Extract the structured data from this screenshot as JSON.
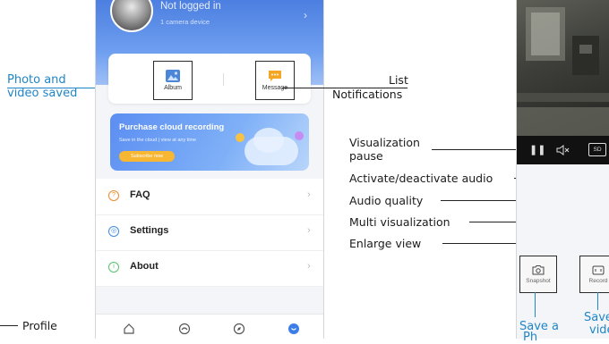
{
  "annotations": {
    "photo_video_saved_line1": "Photo and",
    "photo_video_saved_line2": "video saved",
    "list": "List",
    "notifications": "Notifications",
    "viz_pause_line1": "Visualization",
    "viz_pause_line2": "pause",
    "audio_toggle": "Activate/deactivate audio",
    "audio_quality": "Audio quality",
    "multi_viz": "Multi visualization",
    "enlarge": "Enlarge view",
    "profile": "Profile",
    "save_photo_line1": "Save a",
    "save_photo_line2": "Ph",
    "save_video_line1": "Save",
    "save_video_line2": "vide"
  },
  "app": {
    "header": {
      "title": "Not logged in",
      "subtitle": "1 camera device"
    },
    "album_label": "Album",
    "message_label": "Message",
    "banner": {
      "title": "Purchase cloud recording",
      "subtitle": "Save in the cloud | view at any time",
      "button": "Subscribe now"
    },
    "menu": [
      {
        "label": "FAQ",
        "icon": "question-icon",
        "color": "#f08a2c"
      },
      {
        "label": "Settings",
        "icon": "settings-icon",
        "color": "#3d8be8"
      },
      {
        "label": "About",
        "icon": "info-icon",
        "color": "#55c46a"
      }
    ]
  },
  "viewer": {
    "quality_badge": "SD",
    "snapshot_label": "Snapshot",
    "record_label": "Record"
  }
}
